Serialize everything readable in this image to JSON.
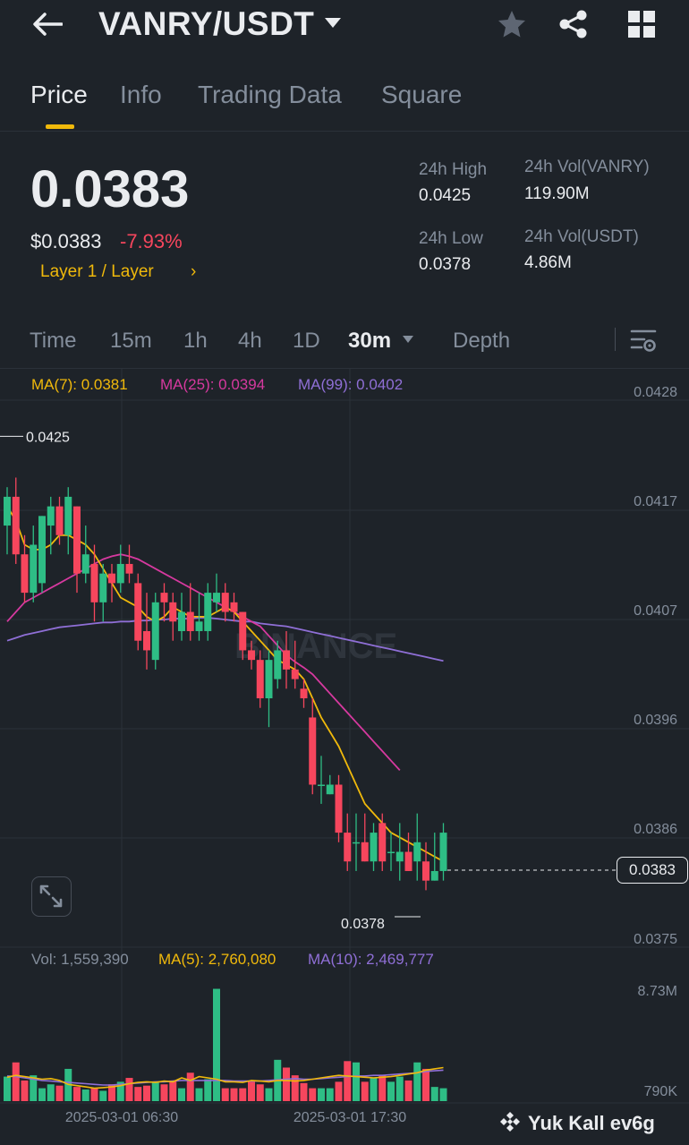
{
  "header": {
    "pair": "VANRY/USDT"
  },
  "tabs": [
    {
      "label": "Price",
      "active": true
    },
    {
      "label": "Info",
      "active": false
    },
    {
      "label": "Trading Data",
      "active": false
    },
    {
      "label": "Square",
      "active": false
    }
  ],
  "price": {
    "last": "0.0383",
    "usd": "$0.0383",
    "change": "-7.93%",
    "category": "Layer 1 / Layer",
    "category_chevron": "›"
  },
  "stats": {
    "high_label": "24h High",
    "high_value": "0.0425",
    "low_label": "24h Low",
    "low_value": "0.0378",
    "vol_base_label": "24h Vol(VANRY)",
    "vol_base_value": "119.90M",
    "vol_quote_label": "24h Vol(USDT)",
    "vol_quote_value": "4.86M"
  },
  "intervals": [
    {
      "label": "Time",
      "active": false
    },
    {
      "label": "15m",
      "active": false
    },
    {
      "label": "1h",
      "active": false
    },
    {
      "label": "4h",
      "active": false
    },
    {
      "label": "1D",
      "active": false
    },
    {
      "label": "30m",
      "active": true
    },
    {
      "label": "Depth",
      "active": false
    }
  ],
  "ma_legend": {
    "ma7": "MA(7): 0.0381",
    "ma25": "MA(25): 0.0394",
    "ma99": "MA(99): 0.0402"
  },
  "vol_legend": {
    "vol": "Vol: 1,559,390",
    "ma5": "MA(5): 2,760,080",
    "ma10": "MA(10): 2,469,777"
  },
  "price_axis": [
    "0.0428",
    "0.0417",
    "0.0407",
    "0.0396",
    "0.0386",
    "0.0375"
  ],
  "volume_axis": [
    "8.73M",
    "790K"
  ],
  "time_axis": [
    "2025-03-01 06:30",
    "2025-03-01 17:30"
  ],
  "annotations": {
    "high_marker": "0.0425",
    "low_marker": "0.0378",
    "current_price_tag": "0.0383"
  },
  "watermark": "Yuk Kall ev6g",
  "chart_watermark": "BINANCE",
  "colors": {
    "background": "#1e2329",
    "up": "#2ebd85",
    "down": "#f6465d",
    "accent": "#f0b90b",
    "ma7": "#f0b90b",
    "ma25": "#d6399f",
    "ma99": "#8f6fd6",
    "muted": "#848e9c"
  },
  "chart_data": {
    "type": "candlestick",
    "interval": "30m",
    "y_range": [
      0.0373,
      0.043
    ],
    "candles": [
      {
        "o": 0.0416,
        "h": 0.042,
        "l": 0.0413,
        "c": 0.0419
      },
      {
        "o": 0.0419,
        "h": 0.0421,
        "l": 0.0412,
        "c": 0.0413
      },
      {
        "o": 0.0413,
        "h": 0.0415,
        "l": 0.0408,
        "c": 0.0409
      },
      {
        "o": 0.0409,
        "h": 0.0416,
        "l": 0.0408,
        "c": 0.0414
      },
      {
        "o": 0.041,
        "h": 0.0417,
        "l": 0.0409,
        "c": 0.0417
      },
      {
        "o": 0.0416,
        "h": 0.0419,
        "l": 0.0413,
        "c": 0.0418
      },
      {
        "o": 0.0418,
        "h": 0.0419,
        "l": 0.0414,
        "c": 0.0415
      },
      {
        "o": 0.0415,
        "h": 0.042,
        "l": 0.0413,
        "c": 0.0419
      },
      {
        "o": 0.0418,
        "h": 0.0418,
        "l": 0.0409,
        "c": 0.0411
      },
      {
        "o": 0.0411,
        "h": 0.0416,
        "l": 0.041,
        "c": 0.0413
      },
      {
        "o": 0.0412,
        "h": 0.0414,
        "l": 0.0406,
        "c": 0.0408
      },
      {
        "o": 0.0408,
        "h": 0.0412,
        "l": 0.0406,
        "c": 0.0411
      },
      {
        "o": 0.0411,
        "h": 0.0412,
        "l": 0.0408,
        "c": 0.041
      },
      {
        "o": 0.041,
        "h": 0.0414,
        "l": 0.0409,
        "c": 0.0412
      },
      {
        "o": 0.0412,
        "h": 0.0414,
        "l": 0.041,
        "c": 0.0411
      },
      {
        "o": 0.041,
        "h": 0.0411,
        "l": 0.0403,
        "c": 0.0404
      },
      {
        "o": 0.0405,
        "h": 0.0409,
        "l": 0.0401,
        "c": 0.0403
      },
      {
        "o": 0.0402,
        "h": 0.0409,
        "l": 0.0401,
        "c": 0.0408
      },
      {
        "o": 0.0409,
        "h": 0.041,
        "l": 0.0406,
        "c": 0.0408
      },
      {
        "o": 0.0408,
        "h": 0.0409,
        "l": 0.0404,
        "c": 0.0406
      },
      {
        "o": 0.0405,
        "h": 0.0409,
        "l": 0.0404,
        "c": 0.0407
      },
      {
        "o": 0.0407,
        "h": 0.041,
        "l": 0.0404,
        "c": 0.0405
      },
      {
        "o": 0.0405,
        "h": 0.0409,
        "l": 0.0404,
        "c": 0.0406
      },
      {
        "o": 0.0405,
        "h": 0.041,
        "l": 0.0404,
        "c": 0.0409
      },
      {
        "o": 0.0408,
        "h": 0.0411,
        "l": 0.0407,
        "c": 0.0409
      },
      {
        "o": 0.0409,
        "h": 0.041,
        "l": 0.0406,
        "c": 0.0407
      },
      {
        "o": 0.0408,
        "h": 0.0409,
        "l": 0.0406,
        "c": 0.0407
      },
      {
        "o": 0.0407,
        "h": 0.0407,
        "l": 0.0402,
        "c": 0.0403
      },
      {
        "o": 0.0403,
        "h": 0.0404,
        "l": 0.0401,
        "c": 0.0402
      },
      {
        "o": 0.0402,
        "h": 0.0403,
        "l": 0.0397,
        "c": 0.0398
      },
      {
        "o": 0.0398,
        "h": 0.0403,
        "l": 0.0395,
        "c": 0.0402
      },
      {
        "o": 0.04,
        "h": 0.0404,
        "l": 0.0399,
        "c": 0.0403
      },
      {
        "o": 0.0403,
        "h": 0.0405,
        "l": 0.0399,
        "c": 0.0401
      },
      {
        "o": 0.0401,
        "h": 0.0404,
        "l": 0.0399,
        "c": 0.04
      },
      {
        "o": 0.0399,
        "h": 0.04,
        "l": 0.0397,
        "c": 0.0398
      },
      {
        "o": 0.0396,
        "h": 0.0398,
        "l": 0.0388,
        "c": 0.0389
      },
      {
        "o": 0.0389,
        "h": 0.0392,
        "l": 0.0387,
        "c": 0.0389
      },
      {
        "o": 0.0388,
        "h": 0.039,
        "l": 0.0388,
        "c": 0.0389
      },
      {
        "o": 0.0389,
        "h": 0.039,
        "l": 0.0383,
        "c": 0.0384
      },
      {
        "o": 0.0384,
        "h": 0.0386,
        "l": 0.038,
        "c": 0.0381
      },
      {
        "o": 0.0383,
        "h": 0.0386,
        "l": 0.038,
        "c": 0.0383
      },
      {
        "o": 0.0383,
        "h": 0.0386,
        "l": 0.0381,
        "c": 0.0381
      },
      {
        "o": 0.0381,
        "h": 0.0385,
        "l": 0.038,
        "c": 0.0384
      },
      {
        "o": 0.0385,
        "h": 0.0386,
        "l": 0.038,
        "c": 0.0381
      },
      {
        "o": 0.0382,
        "h": 0.0384,
        "l": 0.038,
        "c": 0.0382
      },
      {
        "o": 0.0381,
        "h": 0.0385,
        "l": 0.0379,
        "c": 0.0382
      },
      {
        "o": 0.0382,
        "h": 0.0384,
        "l": 0.038,
        "c": 0.038
      },
      {
        "o": 0.0381,
        "h": 0.0386,
        "l": 0.0379,
        "c": 0.0383
      },
      {
        "o": 0.0381,
        "h": 0.0383,
        "l": 0.0378,
        "c": 0.0379
      },
      {
        "o": 0.0379,
        "h": 0.0384,
        "l": 0.0379,
        "c": 0.038
      },
      {
        "o": 0.038,
        "h": 0.0385,
        "l": 0.0379,
        "c": 0.0384
      }
    ],
    "ma7": [
      0.0418,
      0.04165,
      0.0414,
      0.04135,
      0.04135,
      0.0414,
      0.0415,
      0.0415,
      0.04145,
      0.0414,
      0.0413,
      0.04115,
      0.041,
      0.04085,
      0.0408,
      0.04075,
      0.04065,
      0.0406,
      0.04065,
      0.04075,
      0.0407,
      0.04065,
      0.04065,
      0.04065,
      0.0407,
      0.04075,
      0.0407,
      0.0406,
      0.0405,
      0.0404,
      0.0403,
      0.0402,
      0.04015,
      0.0401,
      0.04,
      0.0398,
      0.0396,
      0.03945,
      0.0393,
      0.0391,
      0.0389,
      0.0387,
      0.0386,
      0.0385,
      0.0384,
      0.03835,
      0.0383,
      0.03825,
      0.0382,
      0.03815,
      0.0381
    ],
    "ma25": [
      0.0406,
      0.0407,
      0.0408,
      0.04085,
      0.0409,
      0.04095,
      0.041,
      0.04105,
      0.0411,
      0.04115,
      0.0412,
      0.04125,
      0.04128,
      0.0413,
      0.04128,
      0.04125,
      0.0412,
      0.04115,
      0.0411,
      0.04105,
      0.041,
      0.04095,
      0.0409,
      0.04085,
      0.0408,
      0.04075,
      0.0407,
      0.04065,
      0.0406,
      0.04055,
      0.04045,
      0.04035,
      0.04025,
      0.04018,
      0.04012,
      0.04005,
      0.03995,
      0.03985,
      0.03975,
      0.03965,
      0.03955,
      0.03945,
      0.03935,
      0.03925,
      0.03915,
      0.03905
    ],
    "ma99": [
      0.0404,
      0.04043,
      0.04046,
      0.04048,
      0.0405,
      0.04052,
      0.04054,
      0.04055,
      0.04056,
      0.04057,
      0.04058,
      0.04059,
      0.04059,
      0.0406,
      0.0406,
      0.04061,
      0.04061,
      0.04062,
      0.04062,
      0.04063,
      0.04063,
      0.04063,
      0.04064,
      0.04064,
      0.04063,
      0.04062,
      0.04061,
      0.0406,
      0.0406,
      0.04058,
      0.04057,
      0.04056,
      0.04055,
      0.04053,
      0.04051,
      0.04049,
      0.04047,
      0.04045,
      0.04043,
      0.04041,
      0.04039,
      0.04037,
      0.04035,
      0.04033,
      0.04031,
      0.04029,
      0.04027,
      0.04025,
      0.04023,
      0.04021,
      0.04019
    ],
    "volumes": [
      1.9,
      3.0,
      1.6,
      2.0,
      1.0,
      1.3,
      1.2,
      2.5,
      1.1,
      0.9,
      1.0,
      0.8,
      1.3,
      1.5,
      1.8,
      1.1,
      1.2,
      1.5,
      1.3,
      1.6,
      1.0,
      2.2,
      1.0,
      1.7,
      8.7,
      1.0,
      1.0,
      1.0,
      1.5,
      1.3,
      1.0,
      3.2,
      2.6,
      2.0,
      1.4,
      1.0,
      1.0,
      1.0,
      1.5,
      3.1,
      3.0,
      1.5,
      1.8,
      2.0,
      1.5,
      1.9,
      1.6,
      3.0,
      2.5,
      1.1,
      1.0
    ],
    "vol_ma5": [
      1.85,
      2.0,
      1.9,
      1.8,
      1.7,
      1.75,
      1.6,
      1.3,
      1.2,
      1.1,
      1.0,
      1.05,
      1.1,
      1.2,
      1.35,
      1.45,
      1.5,
      1.45,
      1.55,
      1.5,
      1.8,
      1.6,
      1.9,
      1.8,
      1.7,
      1.5,
      1.5,
      1.45,
      1.6,
      1.55,
      1.5,
      1.6,
      1.6,
      1.55,
      1.6,
      1.7,
      1.8,
      1.9,
      2.0,
      1.95,
      1.9,
      1.85,
      1.8,
      1.85,
      1.9,
      2.0,
      2.1,
      2.2,
      2.4,
      2.5,
      2.6
    ],
    "vol_ma10": [
      1.95,
      1.9,
      1.8,
      1.7,
      1.6,
      1.55,
      1.5,
      1.45,
      1.4,
      1.35,
      1.3,
      1.25,
      1.25,
      1.3,
      1.35,
      1.4,
      1.45,
      1.5,
      1.5,
      1.55,
      1.6,
      1.6,
      1.6,
      1.6,
      1.6,
      1.6,
      1.55,
      1.55,
      1.55,
      1.55,
      1.6,
      1.65,
      1.7,
      1.75,
      1.7,
      1.7,
      1.75,
      1.8,
      1.85,
      1.9,
      1.95,
      1.95,
      2.0,
      2.0,
      2.05,
      2.1,
      2.15,
      2.2,
      2.3,
      2.35,
      2.4
    ],
    "volume_range_M": [
      0.0,
      9.5
    ]
  }
}
